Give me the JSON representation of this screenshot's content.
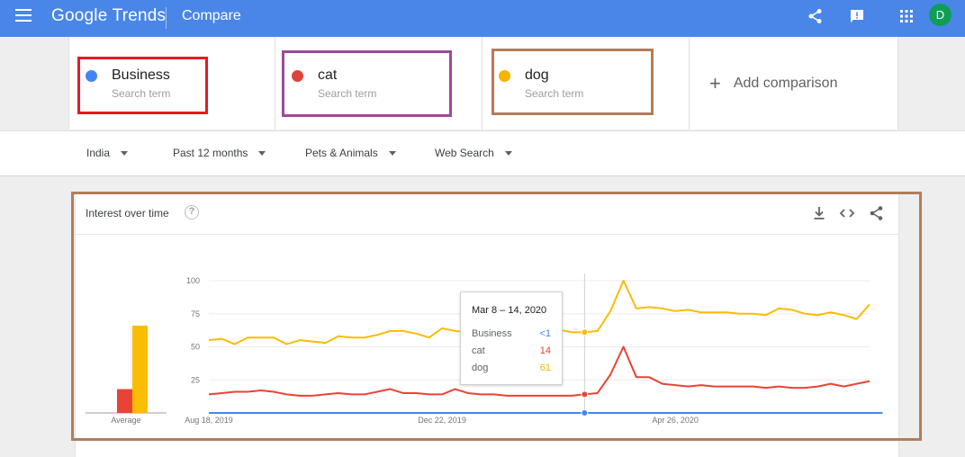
{
  "app": {
    "logo_google": "Google",
    "logo_trends": "Trends",
    "page_title": "Compare",
    "avatar_letter": "D"
  },
  "terms": [
    {
      "name": "Business",
      "sub": "Search term",
      "color": "#4285f4"
    },
    {
      "name": "cat",
      "sub": "Search term",
      "color": "#db4437"
    },
    {
      "name": "dog",
      "sub": "Search term",
      "color": "#f4b400"
    }
  ],
  "add_comparison": "Add comparison",
  "filters": {
    "region": "India",
    "time": "Past 12 months",
    "category": "Pets & Animals",
    "search_type": "Web Search"
  },
  "highlight_colors": {
    "business": "#e31b23",
    "cat": "#9b4a9c",
    "dog": "#b07e5a"
  },
  "card": {
    "title": "Interest over time",
    "help": "?"
  },
  "tooltip": {
    "date": "Mar 8 – 14, 2020",
    "rows": [
      {
        "label": "Business",
        "value": "<1",
        "color": "#4285f4"
      },
      {
        "label": "cat",
        "value": "14",
        "color": "#db4437"
      },
      {
        "label": "dog",
        "value": "61",
        "color": "#f4b400"
      }
    ]
  },
  "chart_data": {
    "type": "line",
    "ylim": [
      0,
      100
    ],
    "y_ticks": [
      25,
      50,
      75,
      100
    ],
    "x_tick_labels": [
      "Aug 18, 2019",
      "Dec 22, 2019",
      "Apr 26, 2020"
    ],
    "x_tick_indices": [
      0,
      18,
      36
    ],
    "hover_index": 29,
    "average_label": "Average",
    "averages": [
      {
        "name": "Business",
        "value": 0,
        "color": "#4285f4"
      },
      {
        "name": "cat",
        "value": 18,
        "color": "#ea4335"
      },
      {
        "name": "dog",
        "value": 66,
        "color": "#fbbc04"
      }
    ],
    "series": [
      {
        "name": "Business",
        "color": "#4285f4",
        "values": [
          0,
          0,
          0,
          0,
          0,
          0,
          0,
          0,
          0,
          0,
          0,
          0,
          0,
          0,
          0,
          0,
          0,
          0,
          0,
          0,
          0,
          0,
          0,
          0,
          0,
          0,
          0,
          0,
          0,
          0,
          0,
          0,
          0,
          0,
          0,
          0,
          0,
          0,
          0,
          0,
          0,
          0,
          0,
          0,
          0,
          0,
          0,
          0,
          0,
          0,
          0,
          0,
          0
        ]
      },
      {
        "name": "cat",
        "color": "#ea4335",
        "values": [
          14,
          15,
          16,
          16,
          17,
          16,
          14,
          13,
          13,
          14,
          15,
          14,
          14,
          16,
          18,
          15,
          15,
          14,
          14,
          18,
          15,
          14,
          14,
          13,
          13,
          13,
          13,
          13,
          13,
          14,
          15,
          29,
          50,
          27,
          27,
          22,
          21,
          20,
          21,
          20,
          20,
          20,
          20,
          19,
          20,
          19,
          19,
          20,
          22,
          20,
          22,
          24
        ]
      },
      {
        "name": "dog",
        "color": "#fbbc04",
        "values": [
          55,
          56,
          52,
          57,
          57,
          57,
          52,
          55,
          54,
          53,
          58,
          57,
          57,
          59,
          62,
          62,
          60,
          57,
          64,
          62,
          61,
          58,
          59,
          58,
          62,
          60,
          59,
          63,
          61,
          61,
          62,
          77,
          100,
          79,
          80,
          79,
          77,
          78,
          76,
          76,
          76,
          75,
          75,
          74,
          79,
          78,
          75,
          74,
          76,
          74,
          71,
          82
        ]
      }
    ]
  }
}
